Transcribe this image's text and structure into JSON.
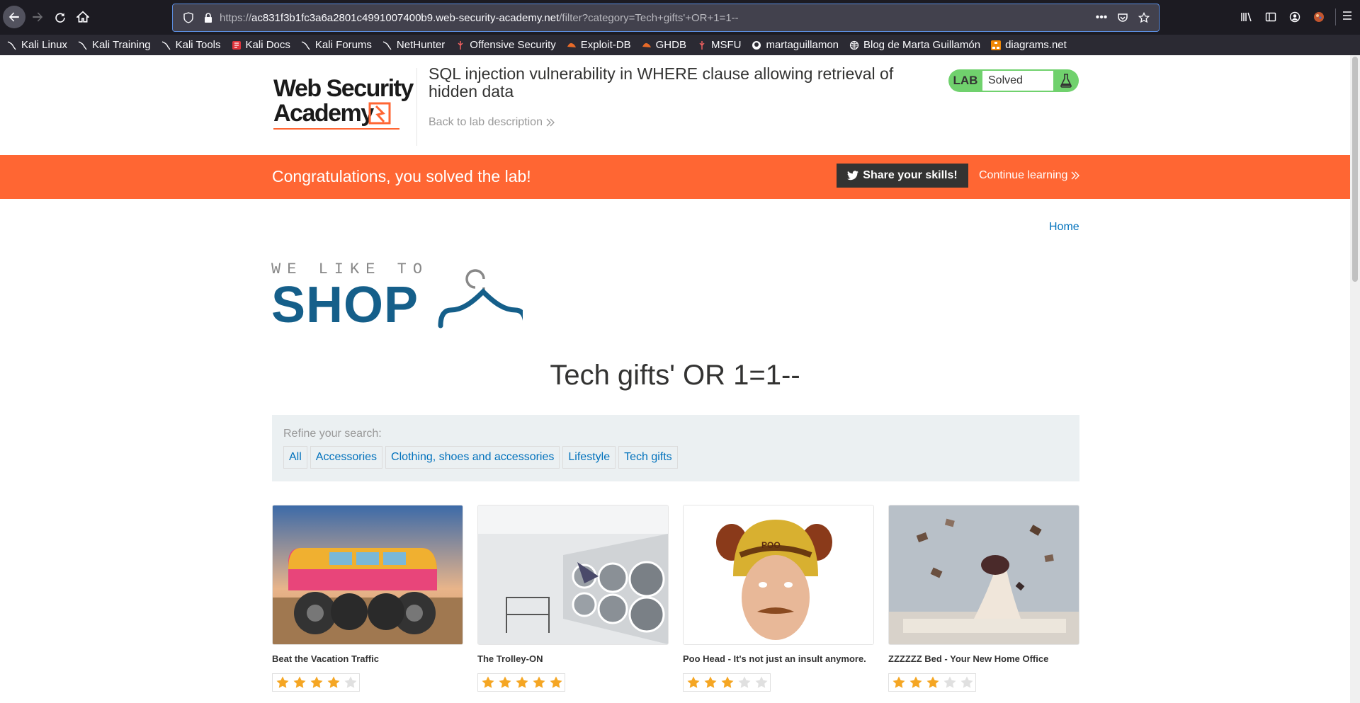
{
  "browser": {
    "url_prefix": "https://",
    "url_host": "ac831f3b1fc3a6a2801c4991007400b9.web-security-academy.net",
    "url_path": "/filter?category=Tech+gifts'+OR+1=1--",
    "bookmarks": [
      {
        "label": "Kali Linux",
        "icon": "kali-icon"
      },
      {
        "label": "Kali Training",
        "icon": "kali-icon"
      },
      {
        "label": "Kali Tools",
        "icon": "kali-icon"
      },
      {
        "label": "Kali Docs",
        "icon": "docs-icon"
      },
      {
        "label": "Kali Forums",
        "icon": "kali-icon"
      },
      {
        "label": "NetHunter",
        "icon": "kali-icon"
      },
      {
        "label": "Offensive Security",
        "icon": "offsec-icon"
      },
      {
        "label": "Exploit-DB",
        "icon": "exploitdb-icon"
      },
      {
        "label": "GHDB",
        "icon": "exploitdb-icon"
      },
      {
        "label": "MSFU",
        "icon": "offsec-icon"
      },
      {
        "label": "martaguillamon",
        "icon": "github-icon"
      },
      {
        "label": "Blog de Marta Guillamón",
        "icon": "globe-icon"
      },
      {
        "label": "diagrams.net",
        "icon": "diagrams-icon"
      }
    ]
  },
  "header": {
    "logo_line1": "Web Security",
    "logo_line2": "Academy",
    "lab_title": "SQL injection vulnerability in WHERE clause allowing retrieval of hidden data",
    "back_link": "Back to lab description",
    "lab_label": "LAB",
    "lab_status": "Solved"
  },
  "banner": {
    "message": "Congratulations, you solved the lab!",
    "share_label": "Share your skills!",
    "continue_label": "Continue learning"
  },
  "nav": {
    "home": "Home"
  },
  "shop_logo": {
    "small": "WE LIKE TO",
    "big": "SHOP"
  },
  "main": {
    "heading": "Tech gifts' OR 1=1--",
    "filter_label": "Refine your search:",
    "filters": [
      "All",
      "Accessories",
      "Clothing, shoes and accessories",
      "Lifestyle",
      "Tech gifts"
    ]
  },
  "products": [
    {
      "name": "Beat the Vacation Traffic",
      "rating": 4
    },
    {
      "name": "The Trolley-ON",
      "rating": 5
    },
    {
      "name": "Poo Head - It's not just an insult anymore.",
      "rating": 3
    },
    {
      "name": "ZZZZZZ Bed - Your New Home Office",
      "rating": 3
    }
  ],
  "colors": {
    "accent_orange": "#ff6633",
    "lab_green": "#70d16d",
    "link_blue": "#0071bc",
    "shop_blue": "#155f8a",
    "star_gold": "#f5a623"
  }
}
